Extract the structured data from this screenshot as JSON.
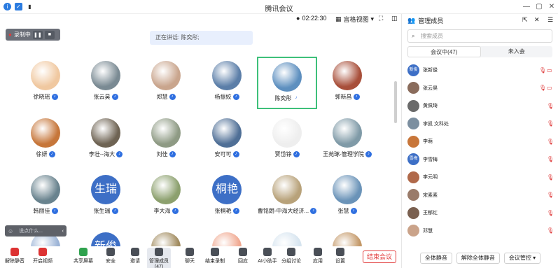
{
  "app_title": "腾讯会议",
  "timer": "02:22:30",
  "view_label": "宫格视图",
  "recording": {
    "label": "录制中"
  },
  "speaking_text": "正在讲话: 陈奕彤;",
  "chat_placeholder": "说点什么...",
  "participants": [
    {
      "name": "徐晓瑶",
      "avatar": "photo",
      "mic": "on"
    },
    {
      "name": "张云昊",
      "avatar": "photo",
      "mic": "on"
    },
    {
      "name": "郑慧",
      "avatar": "photo",
      "mic": "on"
    },
    {
      "name": "杨振姣",
      "avatar": "photo",
      "mic": "on"
    },
    {
      "name": "陈奕彤",
      "avatar": "photo",
      "mic": "speaking",
      "active": true
    },
    {
      "name": "郭新昌",
      "avatar": "photo",
      "mic": "on"
    },
    {
      "name": "徐妍",
      "avatar": "photo",
      "mic": "on"
    },
    {
      "name": "李壮--海大",
      "avatar": "photo",
      "mic": "on"
    },
    {
      "name": "刘佳",
      "avatar": "photo",
      "mic": "on"
    },
    {
      "name": "安可可",
      "avatar": "photo",
      "mic": "on"
    },
    {
      "name": "贾岱铮",
      "avatar": "photo",
      "mic": "on"
    },
    {
      "name": "王苑琢-管理学院",
      "avatar": "photo",
      "mic": "on"
    },
    {
      "name": "韩丽佳",
      "avatar": "photo",
      "mic": "on"
    },
    {
      "name": "张生瑞",
      "avatar": "text",
      "avatar_text": "生瑞",
      "mic": "on"
    },
    {
      "name": "李大海",
      "avatar": "photo",
      "mic": "on"
    },
    {
      "name": "张桐艳",
      "avatar": "text",
      "avatar_text": "桐艳",
      "mic": "on"
    },
    {
      "name": "曹铭朗-中海大经济...",
      "avatar": "photo",
      "mic": "on"
    },
    {
      "name": "张慧",
      "avatar": "photo",
      "mic": "on"
    },
    {
      "name": "",
      "avatar": "photo",
      "mic": ""
    },
    {
      "name": "",
      "avatar": "text",
      "avatar_text": "新俊",
      "mic": ""
    },
    {
      "name": "",
      "avatar": "photo",
      "mic": ""
    },
    {
      "name": "",
      "avatar": "photo",
      "mic": ""
    },
    {
      "name": "",
      "avatar": "photo",
      "mic": ""
    },
    {
      "name": "",
      "avatar": "photo",
      "mic": ""
    }
  ],
  "bottom_toolbar": [
    "解除静音",
    "开启视频",
    "共享屏幕",
    "安全",
    "邀请",
    "管理成员(47)",
    "聊天",
    "结束录制",
    "回应",
    "AI小助手",
    "分组讨论",
    "应用",
    "设置"
  ],
  "end_meeting": "结束会议",
  "panel": {
    "title": "管理成员",
    "search_placeholder": "搜索成员",
    "tabs": [
      "会议中(47)",
      "未入会"
    ],
    "members": [
      {
        "name": "张新俊",
        "avatar_text": "新俊"
      },
      {
        "name": "张云昊",
        "avatar_text": ""
      },
      {
        "name": "黄佩琦",
        "avatar_text": ""
      },
      {
        "name": "李凯 文科处",
        "avatar_text": ""
      },
      {
        "name": "李萌",
        "avatar_text": ""
      },
      {
        "name": "李雪梅",
        "avatar_text": "雪梅"
      },
      {
        "name": "李元明",
        "avatar_text": ""
      },
      {
        "name": "宋素素",
        "avatar_text": ""
      },
      {
        "name": "王郁红",
        "avatar_text": ""
      },
      {
        "name": "邓慧",
        "avatar_text": ""
      }
    ],
    "footer": [
      "全体静音",
      "解除全体静音",
      "会议管控"
    ]
  },
  "colors": {
    "accent": "#2f6fe0",
    "active_border": "#3ec07a",
    "end": "#e23b3b",
    "avatar_text_bg": "#3d6fc6"
  }
}
